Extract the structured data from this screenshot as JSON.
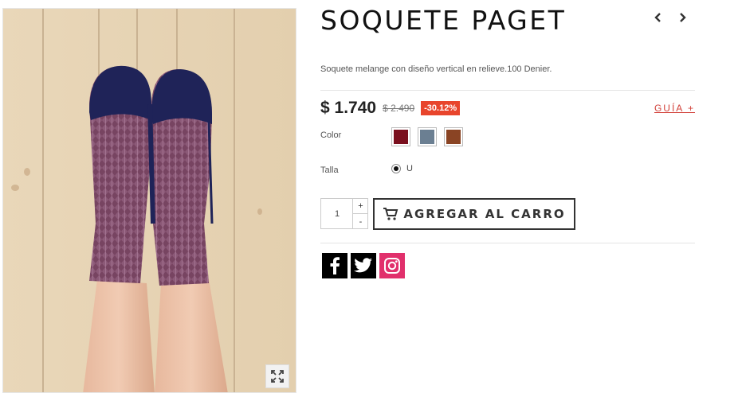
{
  "product": {
    "title": "SOQUETE PAGET",
    "description": "Soquete melange con diseño vertical en relieve.100 Denier.",
    "price": "$ 1.740",
    "old_price": "$ 2.490",
    "discount": "-30.12%",
    "size_guide_label": "GUÍA +"
  },
  "options": {
    "color_label": "Color",
    "colors": [
      {
        "hex": "#7a0f1e"
      },
      {
        "hex": "#6b7f92"
      },
      {
        "hex": "#8a4424"
      }
    ],
    "size_label": "Talla",
    "size_value": "U"
  },
  "cart": {
    "quantity": "1",
    "plus_label": "+",
    "minus_label": "-",
    "add_label": "AGREGAR AL CARRO"
  },
  "social": [
    {
      "icon": "facebook-icon",
      "color": "#000000"
    },
    {
      "icon": "twitter-icon",
      "color": "#000000"
    },
    {
      "icon": "instagram-icon",
      "color": "#e1306c"
    }
  ],
  "colors": {
    "accent": "#d2413a",
    "badge": "#e8452c"
  }
}
